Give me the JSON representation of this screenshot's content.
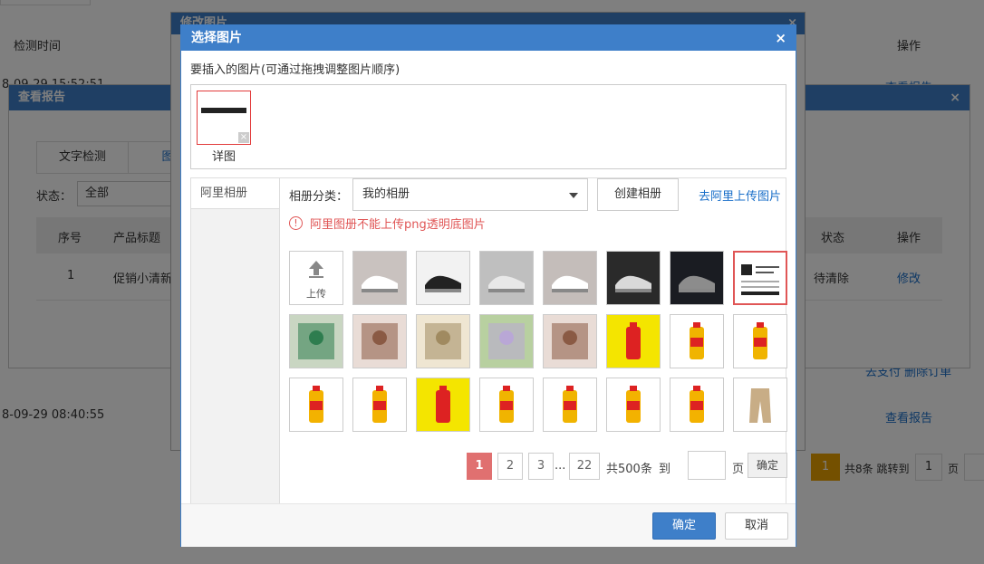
{
  "background": {
    "header_left": "检测时间",
    "header_right": "操作",
    "row1_time": "8-09-29 15:52:51",
    "row1_action": "查看报告",
    "row2_time": "8-09-29 08:40:55",
    "row2_action": "查看报告",
    "row3_action": "去支付 删除订单",
    "report": {
      "title": "查看报告",
      "tab_text": "文字检测",
      "tab_image": "图片",
      "status_label": "状态：",
      "status_value": "全部",
      "col_index": "序号",
      "col_title": "产品标题",
      "col_status": "状态",
      "col_action": "操作",
      "row_index": "1",
      "row_title": "促销小清新",
      "row_status": "待清除",
      "row_action": "修改"
    },
    "edit_title": "修改图片",
    "pager": {
      "current": "1",
      "total_text": "共8条 跳转到",
      "input": "1",
      "page_unit": "页"
    }
  },
  "dialog": {
    "title": "选择图片",
    "close": "×",
    "insert_label": "要插入的图片(可通过拖拽调整图片顺序)",
    "selected": [
      {
        "caption": "详图",
        "remove": "×"
      }
    ],
    "sidebar": {
      "items": [
        {
          "label": "阿里相册"
        }
      ]
    },
    "category_label": "相册分类：",
    "category_value": "我的相册",
    "create_album": "创建相册",
    "upload_link": "去阿里上传图片",
    "warning": "阿里图册不能上传png透明底图片",
    "warning_icon": "!",
    "upload_tile_label": "上传",
    "thumbnails": [
      {
        "name": "shoe-white-1",
        "color": "#c9c2bf",
        "accent": "#ffffff"
      },
      {
        "name": "shoe-black-side",
        "color": "#f2f2f2",
        "accent": "#222222"
      },
      {
        "name": "shoe-grid",
        "color": "#bfbfbf",
        "accent": "#e8e8e8"
      },
      {
        "name": "shoe-white-2",
        "color": "#c4bdba",
        "accent": "#ffffff"
      },
      {
        "name": "shoe-black-dark",
        "color": "#2a2a2a",
        "accent": "#d9d9d9"
      },
      {
        "name": "shoe-black-blue",
        "color": "#1a1c22",
        "accent": "#8c8c8c"
      },
      {
        "name": "business-card",
        "color": "#ffffff",
        "accent": "#222222"
      },
      {
        "name": "book-cover-green",
        "color": "#c9d6c2",
        "accent": "#2e7d4f"
      },
      {
        "name": "portrait-woman-1",
        "color": "#e9dcd6",
        "accent": "#8a5a44"
      },
      {
        "name": "book-cover-cream",
        "color": "#efe6d2",
        "accent": "#a08a60"
      },
      {
        "name": "girl-dress",
        "color": "#b8d0a0",
        "accent": "#b9a7d6"
      },
      {
        "name": "portrait-woman-2",
        "color": "#e9dcd6",
        "accent": "#8a5a44"
      },
      {
        "name": "oil-yellow-label",
        "color": "#f4e500",
        "accent": "#d22"
      },
      {
        "name": "oil-bottle-text-1",
        "color": "#ffffff",
        "accent": "#f0b400"
      },
      {
        "name": "oil-bottle-text-2",
        "color": "#ffffff",
        "accent": "#f0b400"
      },
      {
        "name": "oil-bottle-1",
        "color": "#ffffff",
        "accent": "#f3b200"
      },
      {
        "name": "oil-bottle-pink",
        "color": "#ffffff",
        "accent": "#f3b200"
      },
      {
        "name": "oil-yellow-label-2",
        "color": "#f4e500",
        "accent": "#d22"
      },
      {
        "name": "oil-bottle-text-3",
        "color": "#ffffff",
        "accent": "#f0b400"
      },
      {
        "name": "oil-bottle-text-4",
        "color": "#ffffff",
        "accent": "#f0b400"
      },
      {
        "name": "oil-bottle-2",
        "color": "#ffffff",
        "accent": "#f3b200"
      },
      {
        "name": "oil-bottle-pink-2",
        "color": "#ffffff",
        "accent": "#f3b200"
      },
      {
        "name": "pants-khaki",
        "color": "#ffffff",
        "accent": "#c8ad86"
      }
    ],
    "pager": {
      "pages": [
        "1",
        "2",
        "3"
      ],
      "ellipsis": "...",
      "last_page": "22",
      "total": "共500条",
      "goto_label": "到",
      "page_unit": "页",
      "confirm": "确定",
      "input_value": ""
    },
    "ok": "确定",
    "cancel": "取消"
  },
  "colors": {
    "accent": "#3e7fc9",
    "danger": "#e05656",
    "pager_active": "#e07070"
  }
}
